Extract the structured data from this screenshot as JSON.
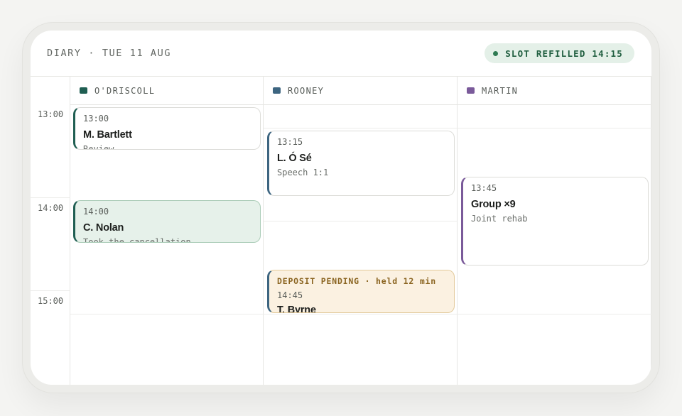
{
  "header": {
    "title": "DIARY · TUE 11 AUG",
    "badge": "SLOT REFILLED 14:15"
  },
  "colors": {
    "odriscoll": "#1f5e52",
    "rooney": "#3d6580",
    "martin": "#7a5a9a",
    "refilled_bg": "#e6f1ea",
    "pending_bg": "#fbf1e1"
  },
  "columns": [
    {
      "name": "O'DRISCOLL"
    },
    {
      "name": "ROONEY"
    },
    {
      "name": "MARTIN"
    }
  ],
  "time_labels": [
    "13:00",
    "14:00",
    "15:00"
  ],
  "appointments": {
    "bartlett": {
      "time": "13:00",
      "name": "M. Bartlett",
      "detail": "Review"
    },
    "nolan": {
      "time": "14:00",
      "name": "C. Nolan",
      "detail": "Took the cancellation"
    },
    "ose": {
      "time": "13:15",
      "name": "L. Ó Sé",
      "detail": "Speech 1:1"
    },
    "byrne": {
      "flag": "DEPOSIT PENDING · held 12 min",
      "time": "14:45",
      "name": "T. Byrne"
    },
    "group": {
      "time": "13:45",
      "name": "Group ×9",
      "detail": "Joint rehab"
    }
  }
}
